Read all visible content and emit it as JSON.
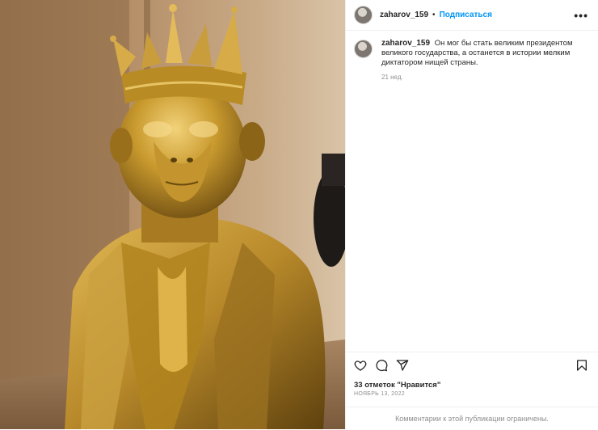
{
  "post": {
    "username": "zaharov_159",
    "follow_label": "Подписаться",
    "separator": "•",
    "more_label": "•••",
    "caption_text": "Он мог бы стать великим президентом великого государства, а останется в истории мелким диктатором нищей страны.",
    "age": "21 нед.",
    "likes": "33 отметок \"Нравится\"",
    "date": "НОЯБРЬ 13, 2022",
    "comments_disabled": "Комментарии к этой публикации ограничены."
  },
  "icons": {
    "like": "heart-icon",
    "comment": "comment-icon",
    "share": "share-icon",
    "save": "bookmark-icon"
  },
  "colors": {
    "accent": "#0095f6",
    "text": "#262626",
    "muted": "#8e8e8e",
    "border": "#efefef"
  }
}
